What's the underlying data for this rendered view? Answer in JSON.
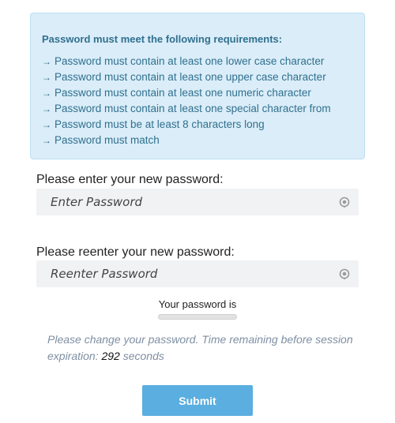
{
  "requirements": {
    "title": "Password must meet the following requirements:",
    "arrow": "→",
    "items": [
      "Password must contain at least one lower case character",
      "Password must contain at least one upper case character",
      "Password must contain at least one numeric character",
      "Password must contain at least one special character from",
      "Password must be at least 8 characters long",
      "Password must match"
    ]
  },
  "new_password": {
    "label": "Please enter your new password:",
    "placeholder": "Enter Password",
    "value": ""
  },
  "reenter_password": {
    "label": "Please reenter your new password:",
    "placeholder": "Reenter Password",
    "value": ""
  },
  "strength": {
    "label": "Your password is",
    "level": 0
  },
  "expiry": {
    "text_before": "Please change your password. Time remaining before session expiration: ",
    "seconds": "292",
    "text_after": " seconds"
  },
  "submit_label": "Submit",
  "colors": {
    "info_bg": "#daedf8",
    "info_text": "#31708f",
    "button": "#5aaee0"
  }
}
